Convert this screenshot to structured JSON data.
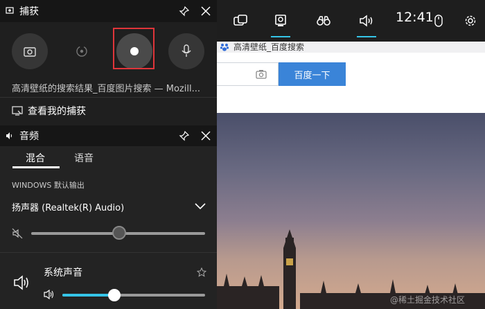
{
  "topbar": {
    "time": "12:41",
    "icons": [
      "widget-icon",
      "capture-icon",
      "binoculars-icon",
      "speaker-icon",
      "mouse-icon",
      "gear-icon"
    ]
  },
  "browser": {
    "tab_title": "高清壁纸_百度搜索",
    "search_button": "百度一下"
  },
  "capture": {
    "title": "捕获",
    "app_name": "高清壁纸的搜索结果_百度图片搜索 — Mozill...",
    "view_captures": "查看我的捕获",
    "highlight_color": "#e0353a"
  },
  "audio": {
    "title": "音频",
    "tabs": [
      {
        "label": "混合",
        "active": true
      },
      {
        "label": "语音",
        "active": false
      }
    ],
    "output_label": "WINDOWS 默认输出",
    "device": "扬声器 (Realtek(R) Audio)",
    "master_volume": 0.5,
    "app_name": "系统声音",
    "app_volume": 0.4,
    "accent": "#35c5e8"
  },
  "watermark": "@稀土掘金技术社区"
}
